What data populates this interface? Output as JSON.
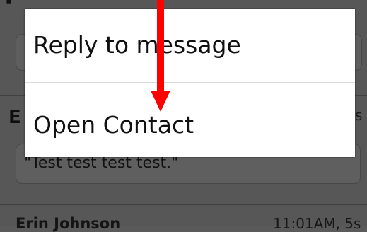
{
  "background": {
    "top_sender_clip": "T",
    "middle_sender_initial": "E",
    "middle_time_clip": "s",
    "middle_message": "\"Test test test test.\"",
    "bottom_sender": "Erin Johnson",
    "bottom_time": "11:01AM, 5s"
  },
  "menu": {
    "items": [
      {
        "label": "Reply to message"
      },
      {
        "label": "Open Contact"
      }
    ]
  },
  "annotation": {
    "arrow_color": "#ff0000",
    "arrow_direction": "down"
  },
  "colors": {
    "dim_background": "#575757",
    "menu_background": "#ffffff",
    "menu_text": "#111111"
  }
}
